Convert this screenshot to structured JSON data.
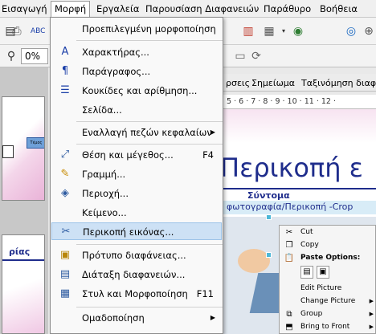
{
  "menubar": {
    "items": [
      "Εισαγωγή",
      "Μορφή",
      "Εργαλεία",
      "Παρουσίαση Διαφανειών",
      "Παράθυρο",
      "Βοήθεια"
    ]
  },
  "toolbar": {
    "zoom_value": "0%"
  },
  "format_menu": {
    "items": [
      {
        "label": "Προεπιλεγμένη μορφοποίηση",
        "shortcut": "",
        "icon": "",
        "submenu": false
      },
      {
        "label": "Χαρακτήρας...",
        "shortcut": "",
        "icon": "character-icon",
        "submenu": false
      },
      {
        "label": "Παράγραφος...",
        "shortcut": "",
        "icon": "paragraph-icon",
        "submenu": false
      },
      {
        "label": "Κουκίδες και αρίθμηση...",
        "shortcut": "",
        "icon": "bullets-icon",
        "submenu": false
      },
      {
        "label": "Σελίδα...",
        "shortcut": "",
        "icon": "",
        "submenu": false
      },
      {
        "label": "Εναλλαγή πεζών κεφαλαίων",
        "shortcut": "",
        "icon": "",
        "submenu": true
      },
      {
        "label": "Θέση και μέγεθος...",
        "shortcut": "F4",
        "icon": "position-size-icon",
        "submenu": false
      },
      {
        "label": "Γραμμή...",
        "shortcut": "",
        "icon": "line-icon",
        "submenu": false
      },
      {
        "label": "Περιοχή...",
        "shortcut": "",
        "icon": "area-fill-icon",
        "submenu": false
      },
      {
        "label": "Κείμενο...",
        "shortcut": "",
        "icon": "",
        "submenu": false
      },
      {
        "label": "Περικοπή εικόνας...",
        "shortcut": "",
        "icon": "crop-icon",
        "submenu": false
      },
      {
        "label": "Πρότυπο διαφάνειας...",
        "shortcut": "",
        "icon": "slide-template-icon",
        "submenu": false
      },
      {
        "label": "Διάταξη διαφανειών...",
        "shortcut": "",
        "icon": "slide-layout-icon",
        "submenu": false
      },
      {
        "label": "Στυλ και Μορφοποίηση",
        "shortcut": "F11",
        "icon": "styles-icon",
        "submenu": false
      },
      {
        "label": "Ομαδοποίηση",
        "shortcut": "",
        "icon": "",
        "submenu": true
      }
    ],
    "highlighted_index": 10
  },
  "view_tabs": {
    "items": [
      "ρσεις",
      "Σημείωμα",
      "Ταξινόμηση διαφ"
    ]
  },
  "ruler": {
    "text": "· 5 · 6 · 7 · 8 · 9 · 10 · 11 · 12 ·"
  },
  "slide": {
    "title": "Περικοπή ε",
    "subtitle_bold": "Σύντομα",
    "subtitle_line": "φωτογραφία/Περικοπή -Crop"
  },
  "thumbs": {
    "diagram_label": "Τέμος",
    "thumb2_title": "ρίας"
  },
  "context_menu": {
    "items": [
      {
        "label": "Cut",
        "icon": "cut-icon",
        "submenu": false,
        "bold": false
      },
      {
        "label": "Copy",
        "icon": "copy-icon",
        "submenu": false,
        "bold": false
      },
      {
        "label": "Paste Options:",
        "icon": "paste-icon",
        "submenu": false,
        "bold": true
      },
      {
        "label": "",
        "icon": "paste-options-icon",
        "submenu": false,
        "bold": false
      },
      {
        "label": "Edit Picture",
        "icon": "",
        "submenu": false,
        "bold": false
      },
      {
        "label": "Change Picture",
        "icon": "",
        "submenu": true,
        "bold": false
      },
      {
        "label": "Group",
        "icon": "group-icon",
        "submenu": true,
        "bold": false
      },
      {
        "label": "Bring to Front",
        "icon": "bring-front-icon",
        "submenu": true,
        "bold": false
      }
    ]
  },
  "colors": {
    "accent_blue": "#1f2d8c",
    "menu_highlight": "#cde1f5",
    "slide_pink": "#e9b3d8"
  }
}
